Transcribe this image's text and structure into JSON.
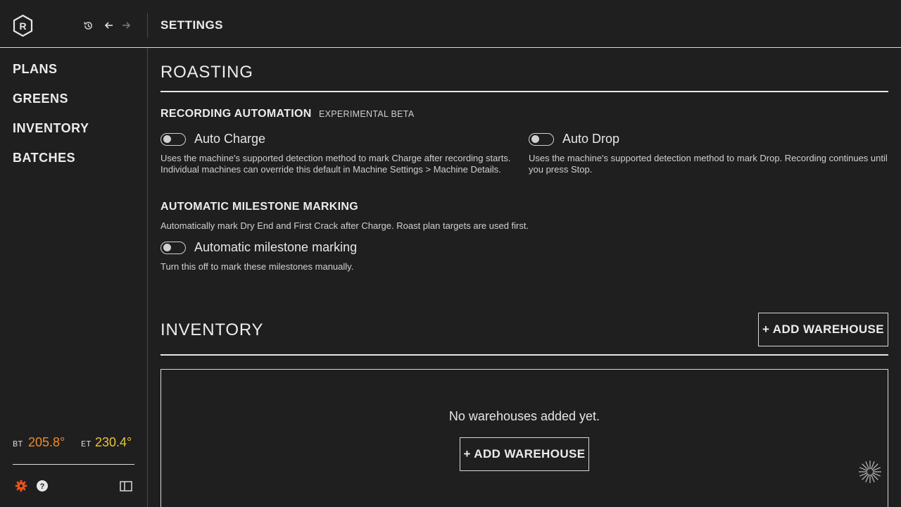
{
  "app": {
    "page_title": "SETTINGS",
    "icons": {
      "logo": "r-hexagon-logo",
      "history": "history-icon",
      "back": "arrow-left-icon",
      "forward": "arrow-right-icon"
    }
  },
  "sidebar": {
    "items": [
      {
        "label": "PLANS"
      },
      {
        "label": "GREENS"
      },
      {
        "label": "INVENTORY"
      },
      {
        "label": "BATCHES"
      }
    ],
    "temps": {
      "bt_label": "BT",
      "bt_value": "205.8°",
      "bt_color": "#f08a2c",
      "et_label": "ET",
      "et_value": "230.4°",
      "et_color": "#e8c636"
    },
    "footer_icons": {
      "settings": "gear-icon",
      "help": "help-icon",
      "panel": "panel-toggle-icon",
      "settings_color": "#e8541d"
    }
  },
  "roasting": {
    "title": "ROASTING",
    "recording": {
      "title": "RECORDING AUTOMATION",
      "badge": "EXPERIMENTAL BETA",
      "auto_charge": {
        "label": "Auto Charge",
        "desc": "Uses the machine's supported detection method to mark Charge after recording starts. Individual machines can override this default in Machine Settings > Machine Details."
      },
      "auto_drop": {
        "label": "Auto Drop",
        "desc": "Uses the machine's supported detection method to mark Drop. Recording continues until you press Stop."
      }
    },
    "milestone": {
      "title": "AUTOMATIC MILESTONE MARKING",
      "desc": "Automatically mark Dry End and First Crack after Charge. Roast plan targets are used first.",
      "toggle_label": "Automatic milestone marking",
      "toggle_desc": "Turn this off to mark these milestones manually."
    }
  },
  "inventory": {
    "title": "INVENTORY",
    "add_button": "+ ADD WAREHOUSE",
    "empty_text": "No warehouses added yet.",
    "empty_button": "+ ADD WAREHOUSE"
  },
  "status": {
    "loading_icon": "spinner-icon"
  }
}
